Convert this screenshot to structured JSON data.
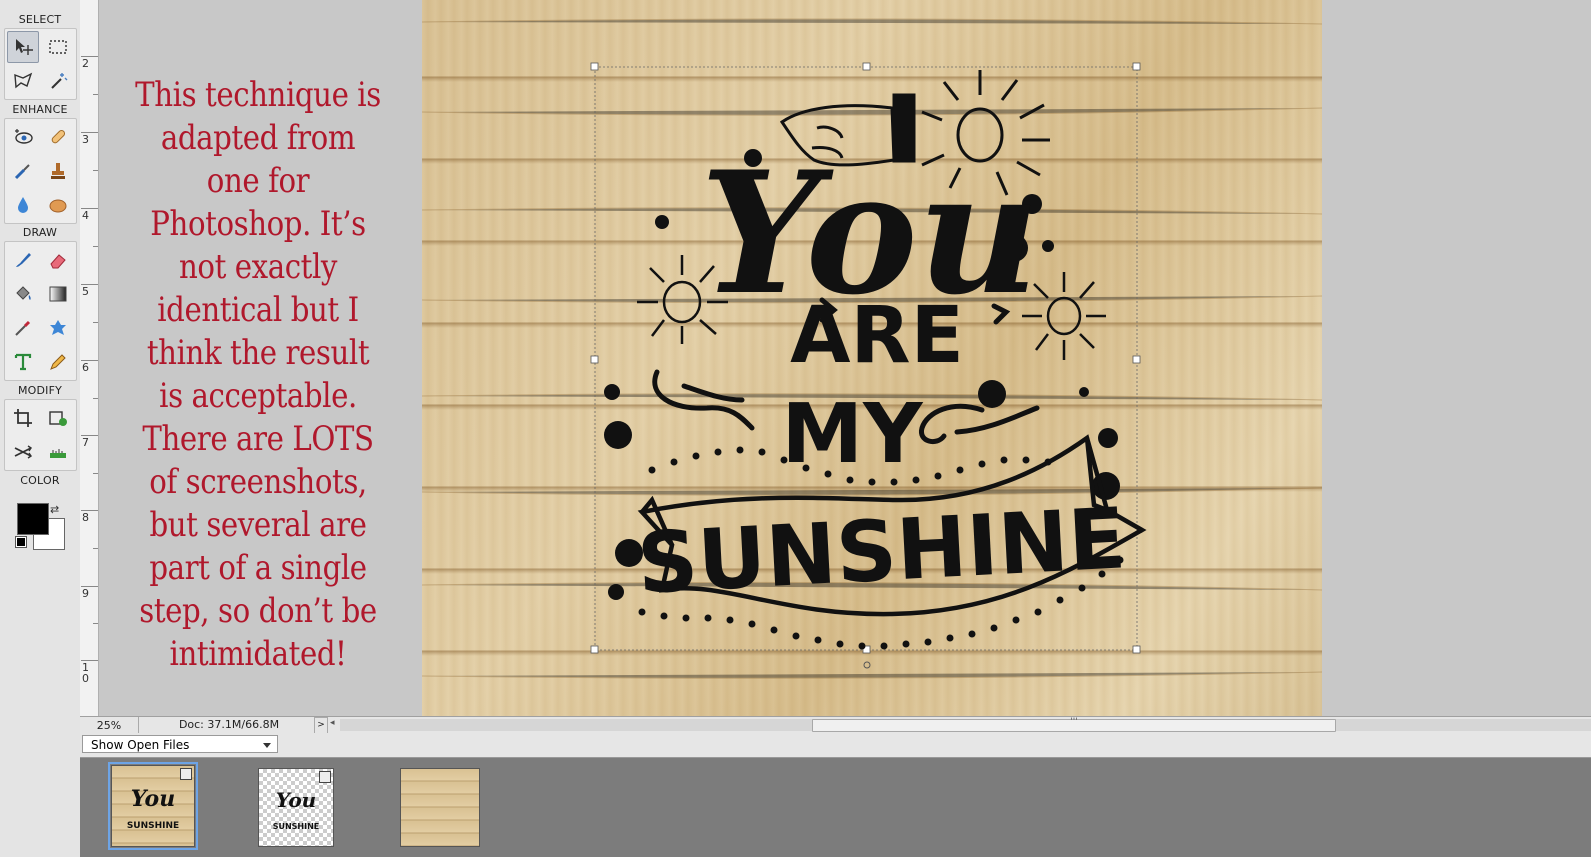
{
  "toolbox": {
    "sections": {
      "select": "SELECT",
      "enhance": "ENHANCE",
      "draw": "DRAW",
      "modify": "MODIFY",
      "color": "COLOR"
    },
    "tools": {
      "select": [
        "move-tool-icon",
        "rectangular-marquee-icon",
        "lasso-icon",
        "magic-wand-icon"
      ],
      "enhance": [
        "red-eye-icon",
        "spot-healing-icon",
        "smart-brush-icon",
        "clone-stamp-icon",
        "blur-icon",
        "sponge-icon"
      ],
      "draw": [
        "brush-icon",
        "eraser-icon",
        "paint-bucket-icon",
        "gradient-icon",
        "eyedropper-icon",
        "custom-shape-icon",
        "type-icon",
        "pencil-icon"
      ],
      "modify": [
        "crop-icon",
        "recompose-icon",
        "content-aware-move-icon",
        "straighten-icon"
      ]
    },
    "foreground_color": "#000000",
    "background_color": "#ffffff"
  },
  "ruler": {
    "marks": [
      "2",
      "3",
      "4",
      "5",
      "6",
      "7",
      "8",
      "9",
      "1\n0"
    ]
  },
  "note": {
    "text": "This technique is adapted from one for Photoshop. It’s not exactly identical but I think the result is acceptable. There are LOTS of screenshots, but several are part of a single step, so don’t be intimidated!",
    "color": "#b0182c"
  },
  "artwork": {
    "word1": "You",
    "word2": "ARE",
    "word3": "MY",
    "word4": "SUNSHINE"
  },
  "statusbar": {
    "zoom": "25%",
    "doc": "Doc: 37.1M/66.8M",
    "arrow": ">",
    "scroll_grip": "'''"
  },
  "photo_bin": {
    "dropdown": "Show Open Files",
    "thumbnails": [
      {
        "name": "wood-with-text",
        "selected": true
      },
      {
        "name": "text-layer-transparent",
        "selected": false
      },
      {
        "name": "wood-background",
        "selected": false
      }
    ]
  }
}
